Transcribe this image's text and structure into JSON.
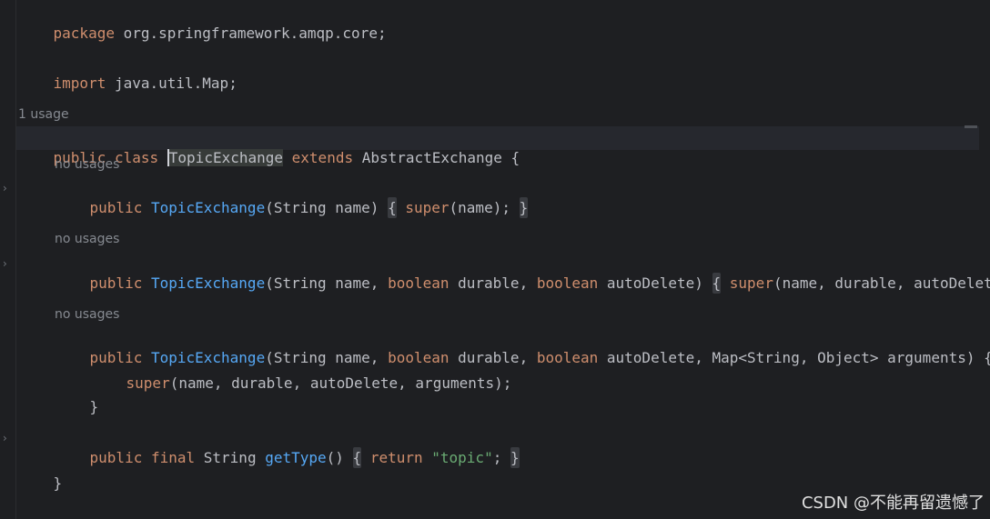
{
  "code": {
    "package_kw": "package",
    "package_name": " org.springframework.amqp.core;",
    "import_kw": "import",
    "import_name": " java.util.Map;",
    "class_usage": "1 usage",
    "class_public": "public",
    "class_class": "class",
    "class_name": "TopicExchange",
    "class_extends": "extends",
    "class_parent": " AbstractExchange {",
    "ctor1": {
      "usage": "no usages",
      "public": "public",
      "name": "TopicExchange",
      "params": "(String name)",
      "open": "{",
      "super": "super",
      "args": "(name);",
      "close": "}"
    },
    "ctor2": {
      "usage": "no usages",
      "public": "public",
      "name": "TopicExchange",
      "p1": "(String name, ",
      "bool1": "boolean",
      "p2": " durable, ",
      "bool2": "boolean",
      "p3": " autoDelete)",
      "open": "{",
      "super": "super",
      "args": "(name, durable, autoDelete); }"
    },
    "ctor3": {
      "usage": "no usages",
      "public": "public",
      "name": "TopicExchange",
      "p1": "(String name, ",
      "bool1": "boolean",
      "p2": " durable, ",
      "bool2": "boolean",
      "p3": " autoDelete, Map<String, Object> arguments) {",
      "super": "super",
      "args": "(name, durable, autoDelete, arguments);",
      "close": "}"
    },
    "getType": {
      "public": "public",
      "final": "final",
      "ret_type": " String ",
      "name": "getType",
      "parens": "()",
      "open": "{",
      "return": "return",
      "value": "\"topic\"",
      "semi": ";",
      "close": "}"
    },
    "class_close": "}"
  },
  "gutter": {
    "fold_icon": "chevron-right-icon",
    "fold_glyph": "›"
  },
  "watermark": "CSDN @不能再留遗憾了",
  "colors": {
    "background": "#1e1f22",
    "keyword": "#cf8e6d",
    "function": "#56a8f5",
    "string": "#6aab73",
    "text": "#bcbec4",
    "hint": "#868a91"
  }
}
